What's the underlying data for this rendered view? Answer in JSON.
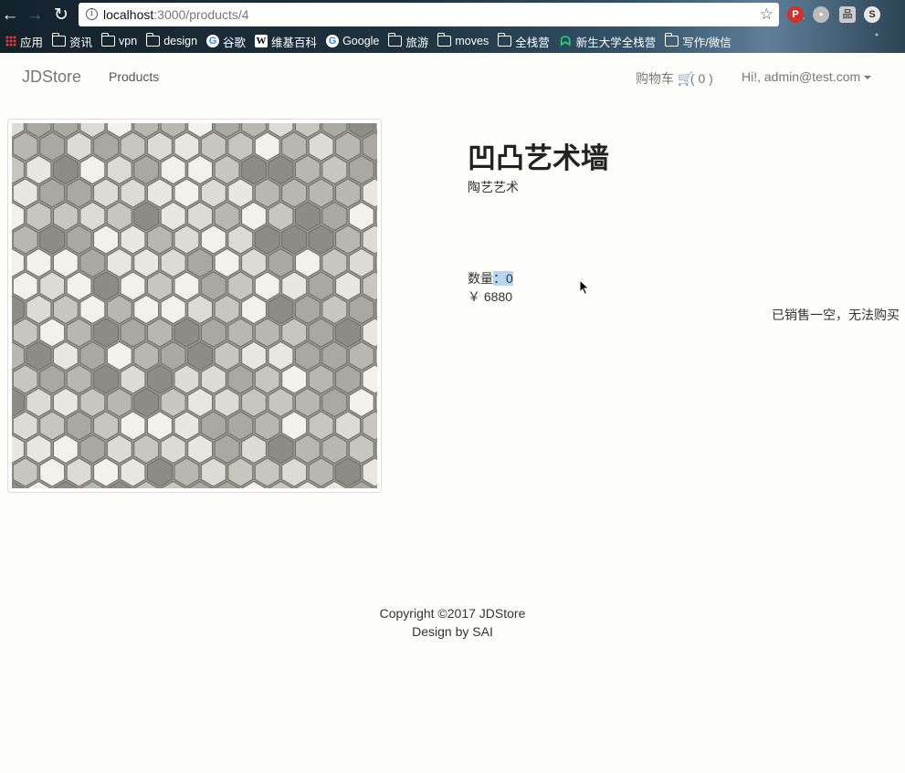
{
  "browser": {
    "url_host": "localhost",
    "url_path": ":3000/products/4",
    "icons": {
      "back": "back-arrow-icon",
      "forward": "forward-arrow-icon",
      "reload": "reload-icon",
      "info": "info-icon",
      "star": "star-icon"
    },
    "bookmarks": [
      {
        "label": "应用",
        "icon": "apps-icon"
      },
      {
        "label": "资讯",
        "icon": "folder-icon"
      },
      {
        "label": "vpn",
        "icon": "folder-icon"
      },
      {
        "label": "design",
        "icon": "folder-icon"
      },
      {
        "label": "谷歌",
        "icon": "google-icon"
      },
      {
        "label": "维基百科",
        "icon": "wikipedia-icon"
      },
      {
        "label": "Google",
        "icon": "google-icon"
      },
      {
        "label": "旅游",
        "icon": "folder-icon"
      },
      {
        "label": "moves",
        "icon": "folder-icon"
      },
      {
        "label": "全栈营",
        "icon": "folder-icon"
      },
      {
        "label": "新生大学全栈营",
        "icon": "xinsheng-icon"
      },
      {
        "label": "写作/微信",
        "icon": "folder-icon"
      }
    ]
  },
  "navbar": {
    "brand": "JDStore",
    "products": "Products",
    "cart_label": "购物车",
    "cart_count": "( 0 )",
    "user": "Hi!, admin@test.com"
  },
  "product": {
    "title": "凹凸艺术墙",
    "description": "陶艺艺术",
    "quantity_label": "数量",
    "quantity_value": "：0",
    "price": "￥ 6880",
    "status": "已销售一空，无法购买"
  },
  "footer": {
    "copyright": "Copyright ©2017 JDStore",
    "design": "Design by SAI"
  },
  "colors": {
    "accent_selection": "#b5d5f3",
    "brand": "#777777"
  }
}
